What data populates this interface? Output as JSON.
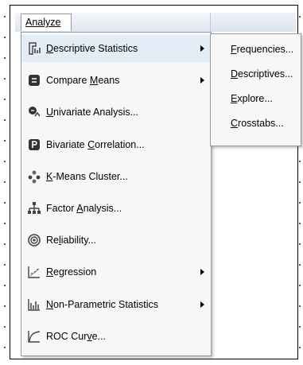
{
  "menubar": {
    "title": "Analyze"
  },
  "menu": {
    "items": [
      {
        "label": "Descriptive Statistics",
        "mnemonic": "D",
        "rest": "escriptive Statistics",
        "icon": "descriptive-stats-icon",
        "submenu": true,
        "active": true
      },
      {
        "label": "Compare Means",
        "pre": "Compare ",
        "mnemonic": "M",
        "rest": "eans",
        "icon": "compare-means-icon",
        "submenu": true
      },
      {
        "label": "Univariate Analysis...",
        "mnemonic": "U",
        "rest": "nivariate Analysis...",
        "icon": "univariate-icon",
        "submenu": false
      },
      {
        "label": "Bivariate Correlation...",
        "pre": "Bivariate ",
        "mnemonic": "C",
        "rest": "orrelation...",
        "icon": "bivariate-icon",
        "submenu": false
      },
      {
        "label": "K-Means Cluster...",
        "mnemonic": "K",
        "rest": "-Means Cluster...",
        "icon": "cluster-icon",
        "submenu": false
      },
      {
        "label": "Factor Analysis...",
        "pre": "Factor ",
        "mnemonic": "A",
        "rest": "nalysis...",
        "icon": "factor-analysis-icon",
        "submenu": false
      },
      {
        "label": "Reliability...",
        "pre": "Re",
        "mnemonic": "l",
        "rest": "iability...",
        "icon": "reliability-icon",
        "submenu": false
      },
      {
        "label": "Regression",
        "mnemonic": "R",
        "rest": "egression",
        "icon": "regression-icon",
        "submenu": true
      },
      {
        "label": "Non-Parametric Statistics",
        "mnemonic": "N",
        "rest": "on-Parametric Statistics",
        "icon": "nonparametric-icon",
        "submenu": true
      },
      {
        "label": "ROC Curve...",
        "pre": "ROC Cur",
        "mnemonic": "v",
        "rest": "e...",
        "icon": "roc-curve-icon",
        "submenu": false
      }
    ]
  },
  "submenu": {
    "items": [
      {
        "label": "Frequencies...",
        "mnemonic": "F",
        "rest": "requencies..."
      },
      {
        "label": "Descriptives...",
        "mnemonic": "D",
        "rest": "escriptives..."
      },
      {
        "label": "Explore...",
        "mnemonic": "E",
        "rest": "xplore..."
      },
      {
        "label": "Crosstabs...",
        "mnemonic": "C",
        "rest": "rosstabs..."
      }
    ]
  }
}
